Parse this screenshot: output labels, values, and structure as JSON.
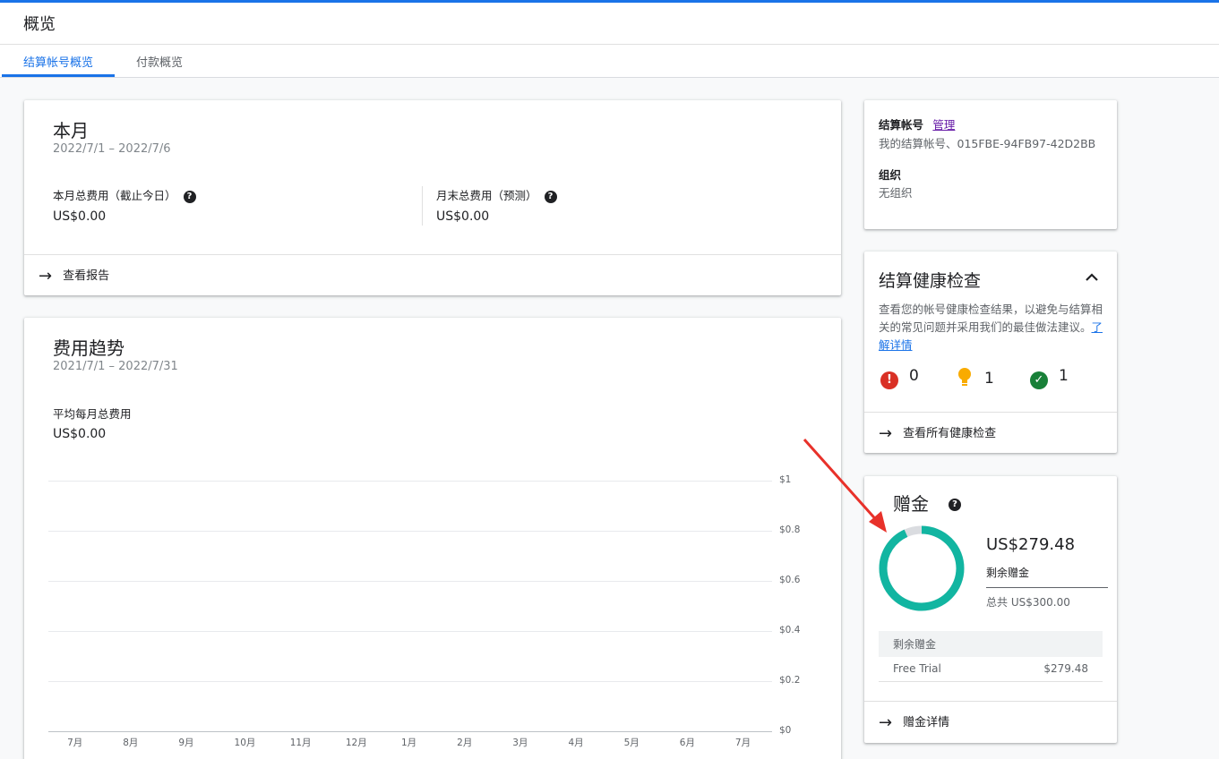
{
  "header": {
    "title": "概览"
  },
  "tabs": [
    {
      "label": "结算帐号概览",
      "active": true
    },
    {
      "label": "付款概览",
      "active": false
    }
  ],
  "this_month": {
    "title": "本月",
    "date_range": "2022/7/1 – 2022/7/6",
    "total_label": "本月总费用（截止今日）",
    "total_value": "US$0.00",
    "forecast_label": "月末总费用（预测）",
    "forecast_value": "US$0.00",
    "action_label": "查看报告"
  },
  "cost_trend": {
    "title": "费用趋势",
    "date_range": "2021/7/1 – 2022/7/31",
    "avg_label": "平均每月总费用",
    "avg_value": "US$0.00"
  },
  "chart_data": {
    "type": "bar",
    "categories": [
      "7月",
      "8月",
      "9月",
      "10月",
      "11月",
      "12月",
      "1月",
      "2月",
      "3月",
      "4月",
      "5月",
      "6月",
      "7月"
    ],
    "values": [
      0,
      0,
      0,
      0,
      0,
      0,
      0,
      0,
      0,
      0,
      0,
      0,
      0
    ],
    "y_ticks": [
      "$1",
      "$0.8",
      "$0.6",
      "$0.4",
      "$0.2",
      "$0"
    ],
    "ylim": [
      0,
      1
    ],
    "grid": true,
    "y_axis_side": "right"
  },
  "billing_account": {
    "label": "结算帐号",
    "manage_link": "管理",
    "account_value": "我的结算帐号、015FBE-94FB97-42D2BB",
    "org_label": "组织",
    "org_value": "无组织"
  },
  "health_check": {
    "title": "结算健康检查",
    "description": "查看您的帐号健康检查结果，以避免与结算相关的常见问题并采用我们的最佳做法建议。",
    "learn_more": "了解详情",
    "errors": "0",
    "warnings": "1",
    "ok": "1",
    "action_label": "查看所有健康检查",
    "colors": {
      "error": "#d93025",
      "warning": "#f9ab00",
      "ok": "#188038"
    }
  },
  "credits": {
    "title": "赠金",
    "remaining_value": "US$279.48",
    "remaining_label": "剩余赠金",
    "total_label": "总共 US$300.00",
    "remaining_fraction": 0.9316,
    "table_header": "剩余赠金",
    "rows": [
      {
        "name": "Free Trial",
        "amount": "$279.48"
      }
    ],
    "action_label": "赠金详情",
    "colors": {
      "ring": "#12b5a1",
      "ring_empty": "#dadce0",
      "arrow": "#e8312a"
    }
  }
}
